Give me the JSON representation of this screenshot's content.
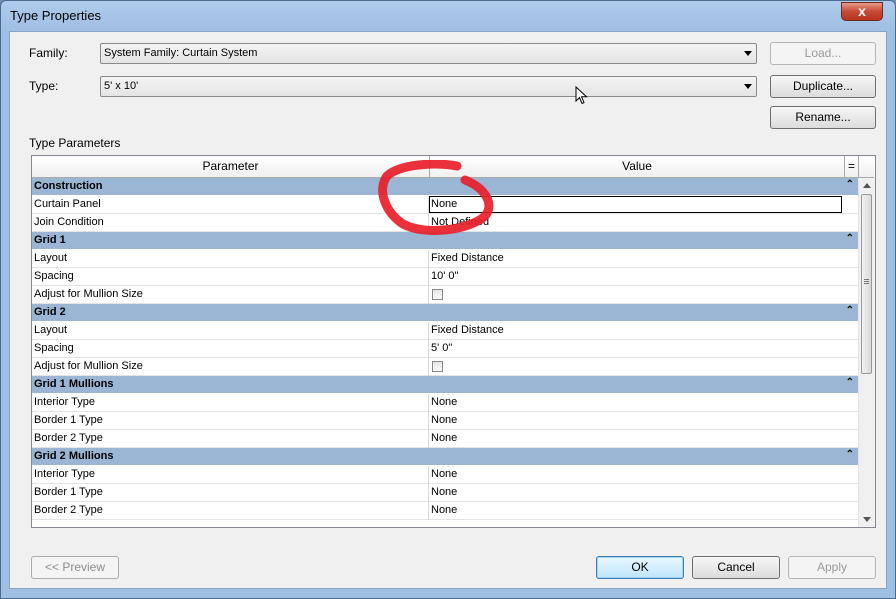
{
  "window": {
    "title": "Type Properties",
    "close_glyph": "x"
  },
  "family": {
    "label": "Family:",
    "value": "System Family: Curtain System"
  },
  "type": {
    "label": "Type:",
    "value": "5' x 10'"
  },
  "buttons": {
    "load": "Load...",
    "duplicate": "Duplicate...",
    "rename": "Rename...",
    "preview": "<< Preview",
    "ok": "OK",
    "cancel": "Cancel",
    "apply": "Apply"
  },
  "section_label": "Type Parameters",
  "grid": {
    "header_parameter": "Parameter",
    "header_value": "Value",
    "header_equals": "=",
    "groups": [
      {
        "name": "Construction",
        "rows": [
          {
            "param": "Curtain Panel",
            "value": "None"
          },
          {
            "param": "Join Condition",
            "value": "Not Defined"
          }
        ]
      },
      {
        "name": "Grid 1",
        "rows": [
          {
            "param": "Layout",
            "value": "Fixed Distance"
          },
          {
            "param": "Spacing",
            "value": "10'  0\""
          },
          {
            "param": "Adjust for Mullion Size",
            "value": ""
          }
        ]
      },
      {
        "name": "Grid 2",
        "rows": [
          {
            "param": "Layout",
            "value": "Fixed Distance"
          },
          {
            "param": "Spacing",
            "value": "5'  0\""
          },
          {
            "param": "Adjust for Mullion Size",
            "value": ""
          }
        ]
      },
      {
        "name": "Grid 1 Mullions",
        "rows": [
          {
            "param": "Interior Type",
            "value": "None"
          },
          {
            "param": "Border 1 Type",
            "value": "None"
          },
          {
            "param": "Border 2 Type",
            "value": "None"
          }
        ]
      },
      {
        "name": "Grid 2 Mullions",
        "rows": [
          {
            "param": "Interior Type",
            "value": "None"
          },
          {
            "param": "Border 1 Type",
            "value": "None"
          },
          {
            "param": "Border 2 Type",
            "value": "None"
          }
        ]
      }
    ],
    "collapse_glyph": "⌃"
  },
  "colors": {
    "group_header": "#9bb6d4",
    "annotation_red": "#e8202a",
    "dialog_bg": "#f0f0f0"
  }
}
